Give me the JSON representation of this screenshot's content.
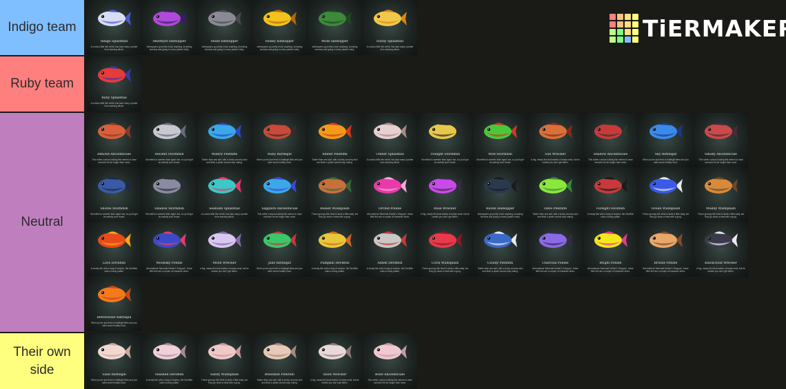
{
  "logo": {
    "text": "TiERMAKER",
    "grid_colors": [
      "#ff7f7f",
      "#ffbf7f",
      "#ffdf7f",
      "#ffff7f",
      "#ff7f7f",
      "#ffbf7f",
      "#ffdf7f",
      "#ffff7f",
      "#bfff7f",
      "#7fff7f",
      "#ffdf7f",
      "#ffff7f",
      "#bfff7f",
      "#7fff7f",
      "#7fbfff",
      "#ffff7f"
    ]
  },
  "tiers": [
    {
      "label": "Indigo team",
      "color": "#7fbfff",
      "items": [
        {
          "name": "Indigo Splashtail",
          "desc": "A curious little fish which has kept many a pirate from starving afloat.",
          "c1": "#d8dcf4",
          "c2": "#4b5bd8"
        },
        {
          "name": "Amethyst Islehopper",
          "desc": "Islehoppers go pretty much anything, including humans and going in every pirate's belly.",
          "c1": "#b04ad8",
          "c2": "#3a1a6a"
        },
        {
          "name": "Stone Islehopper",
          "desc": "Islehoppers go pretty much anything, including humans and going in every pirate's belly.",
          "c1": "#8a8a94",
          "c2": "#4a4a52"
        },
        {
          "name": "Honey Islehopper",
          "desc": "Islehoppers go pretty much anything, including humans and going in every pirate's belly.",
          "c1": "#f4c21a",
          "c2": "#b06a10"
        },
        {
          "name": "Moss Islehopper",
          "desc": "Islehoppers go pretty much anything, including humans and going in every pirate's belly.",
          "c1": "#3c8a3a",
          "c2": "#1e4a20"
        },
        {
          "name": "Sunny Splashtail",
          "desc": "A curious little fish which has kept many a pirate from starving afloat.",
          "c1": "#f2c84a",
          "c2": "#d88a1a"
        }
      ]
    },
    {
      "label": "Ruby team",
      "color": "#ff7f7f",
      "items": [
        {
          "name": "Ruby Splashtail",
          "desc": "A curious little fish which has kept many a pirate from starving afloat.",
          "c1": "#e83a3a",
          "c2": "#3a3aa8"
        }
      ]
    },
    {
      "label": "Neutral",
      "color": "#bf7fbf",
      "items": [
        {
          "name": "Almond Ancientscale",
          "desc": "This rather curious looking fish seems to have survived for far longer than most.",
          "c1": "#d8603a",
          "c2": "#8a3a2a"
        },
        {
          "name": "Ancient Stormfish",
          "desc": "Stormfish is sweeter than aged rum, so you'll get an awfully sore throat.",
          "c1": "#c8c8d0",
          "c2": "#6a6a78"
        },
        {
          "name": "Watery Plentifin",
          "desc": "Tastier than sea salt, with a lovely crunchy skin and flesh a pirate cannot stop eating.",
          "c1": "#3aa8ea",
          "c2": "#2a4ac8"
        },
        {
          "name": "Ruby Battlegill",
          "desc": "When you're just fresh a battlegill bites and you want some healthy food.",
          "c1": "#c84a3a",
          "c2": "#3a2a2a"
        },
        {
          "name": "Amber Plentifin",
          "desc": "Tastier than sea salt, with a lovely crunchy skin and flesh a pirate cannot stop eating.",
          "c1": "#f49a1a",
          "c2": "#d83a1a"
        },
        {
          "name": "Umber Splashtail",
          "desc": "A curious little fish which has kept many a pirate from starving afloat.",
          "c1": "#e8d0d0",
          "c2": "#a88a8a"
        },
        {
          "name": "Twilight Stormfish",
          "desc": "Stormfish is sweeter than aged rum, so you'll get an awfully sore throat.",
          "c1": "#e8c84a",
          "c2": "#2a2a2a"
        },
        {
          "name": "Wild Stormfish",
          "desc": "Stormfish is sweeter than aged rum, so you'll get an awfully sore throat.",
          "c1": "#4ac83a",
          "c2": "#c83a2a"
        },
        {
          "name": "Sun Wrecker",
          "desc": "A big, meaty fish that makes a hearty meal, but be careful you don't get bitten.",
          "c1": "#d8703a",
          "c2": "#8a2a1a"
        },
        {
          "name": "Shadow Ancientscale",
          "desc": "This rather curious looking fish seems to have survived for far longer than most.",
          "c1": "#c83a3a",
          "c2": "#2a3a2a"
        },
        {
          "name": "Sky Battlegill",
          "desc": "When you're just fresh a battlegill bites and you want some healthy food.",
          "c1": "#3a8aea",
          "c2": "#1a3a8a"
        },
        {
          "name": "Smoky Ancientscale",
          "desc": "This rather curious looking fish seems to have survived for far longer than most.",
          "c1": "#c84a4a",
          "c2": "#4a2a3a"
        },
        {
          "name": "Shores Stormfish",
          "desc": "Stormfish is sweeter than aged rum, so you'll get an awfully sore throat.",
          "c1": "#3a5aa8",
          "c2": "#1a2a4a"
        },
        {
          "name": "Shadow Stormfish",
          "desc": "Stormfish is sweeter than aged rum, so you'll get an awfully sore throat.",
          "c1": "#8a8aa0",
          "c2": "#2a2a3a"
        },
        {
          "name": "Seafoam Splashtail",
          "desc": "A curious little fish which has kept many a pirate from starving afloat.",
          "c1": "#3ac8c8",
          "c2": "#e83a6a"
        },
        {
          "name": "Sapphire Ancientscale",
          "desc": "This rather curious looking fish seems to have survived for far longer than most.",
          "c1": "#3aa8ea",
          "c2": "#3a4ad8"
        },
        {
          "name": "Russet Wildsplash",
          "desc": "These grumpy fish tend to taste a little salty, but they go down a treat with a grog.",
          "c1": "#c8703a",
          "c2": "#3a6a3a"
        },
        {
          "name": "Orchid Pondie",
          "desc": "Aberrational 'Mermaid Holder's Shopper', these little fish are a couple of character dives.",
          "c1": "#e83aa8",
          "c2": "#f4a8d8"
        },
        {
          "name": "Rose Wrecker",
          "desc": "A big, meaty fish that makes a hearty meal, but be careful you don't get bitten.",
          "c1": "#c84ae8",
          "c2": "#3a2a4a"
        },
        {
          "name": "Raven Islehopper",
          "desc": "Islehoppers go pretty much anything, including humans and going in every pirate's belly.",
          "c1": "#2a3a4a",
          "c2": "#1a1a2a"
        },
        {
          "name": "Olive Plentifin",
          "desc": "Tastier than sea salt, with a lovely crunchy skin and flesh a pirate cannot stop eating.",
          "c1": "#8ae83a",
          "c2": "#3a8a3a"
        },
        {
          "name": "Forsight Devilfish",
          "desc": "A meaty fish with a tang of sulphur, the Devilfish suits a hardy palate.",
          "c1": "#c83a3a",
          "c2": "#1a1a1a"
        },
        {
          "name": "Ocean Wildsplash",
          "desc": "These grumpy fish tend to taste a little salty, but they go down a treat with a grog.",
          "c1": "#3a5ae8",
          "c2": "#e8e8f0"
        },
        {
          "name": "Muddy Wildsplash",
          "desc": "These grumpy fish tend to taste a little salty, but they go down a treat with a grog.",
          "c1": "#d88a3a",
          "c2": "#6a4a2a"
        },
        {
          "name": "Lava Devilfish",
          "desc": "A meaty fish with a tang of sulphur, the Devilfish suits a hardy palate.",
          "c1": "#e84a1a",
          "c2": "#f4a81a"
        },
        {
          "name": "Moonsky Pondie",
          "desc": "Aberrational 'Mermaid Holder's Shopper', these little fish are a couple of character dives.",
          "c1": "#3a4ac8",
          "c2": "#e83a6a"
        },
        {
          "name": "Moon Wrecker",
          "desc": "A big, meaty fish that makes a hearty meal, but be careful you don't get bitten.",
          "c1": "#d8c8f0",
          "c2": "#8a6aa8"
        },
        {
          "name": "Jade Battlegill",
          "desc": "When you're just fresh a battlegill bites and you want some healthy food.",
          "c1": "#3ac86a",
          "c2": "#c83a3a"
        },
        {
          "name": "Pumpkin Devilfish",
          "desc": "A meaty fish with a tang of sulphur, the Devilfish suits a hardy palate.",
          "c1": "#e8c83a",
          "c2": "#d86a1a"
        },
        {
          "name": "Ashen Devilfish",
          "desc": "A meaty fish with a tang of sulphur, the Devilfish suits a hardy palate.",
          "c1": "#c8c8c8",
          "c2": "#c83a3a"
        },
        {
          "name": "Coral Wildsplash",
          "desc": "These grumpy fish tend to taste a little salty, but they go down a treat with a grog.",
          "c1": "#e83a4a",
          "c2": "#8a1a2a"
        },
        {
          "name": "Cloudy Plentifin",
          "desc": "Tastier than sea salt, with a lovely crunchy skin and flesh a pirate cannot stop eating.",
          "c1": "#3a6ac8",
          "c2": "#e8e8f0"
        },
        {
          "name": "Charcoal Pondie",
          "desc": "Aberrational 'Mermaid Holder's Shopper', these little fish are a couple of character dives.",
          "c1": "#8a6ae8",
          "c2": "#3a2a4a"
        },
        {
          "name": "Bright Pondie",
          "desc": "Aberrational 'Mermaid Holder's Shopper', these little fish are a couple of character dives.",
          "c1": "#f4e81a",
          "c2": "#e83a8a"
        },
        {
          "name": "Bronze Pondie",
          "desc": "Aberrational 'Mermaid Holder's Shopper', these little fish are a couple of character dives.",
          "c1": "#e8a86a",
          "c2": "#8a4a2a"
        },
        {
          "name": "Blackcloud Wrecker",
          "desc": "A big, meaty fish that makes a hearty meal, but be careful you don't get bitten.",
          "c1": "#3a3a4a",
          "c2": "#e8e8f0"
        },
        {
          "name": "Bittersweet Battlegill",
          "desc": "When you're just fresh a battlegill bites and you want some healthy food.",
          "c1": "#f47a1a",
          "c2": "#c84a1a"
        }
      ]
    },
    {
      "label": "Their own side",
      "color": "#ffff7f",
      "items": [
        {
          "name": "Sand Battlegill",
          "desc": "When you're just fresh a battlegill bites and you want some healthy food.",
          "c1": "#f0d8d0",
          "c2": "#c8a8a0"
        },
        {
          "name": "Seashell Devilfish",
          "desc": "A meaty fish with a tang of sulphur, the Devilfish suits a hardy palate.",
          "c1": "#f0d0d8",
          "c2": "#a88a9a"
        },
        {
          "name": "Sandy Wildsplash",
          "desc": "These grumpy fish tend to taste a little salty, but they go down a treat with a grog.",
          "c1": "#f0c8c8",
          "c2": "#c89a9a"
        },
        {
          "name": "Bonedust Plentifin",
          "desc": "Tastier than sea salt, with a lovely crunchy skin and flesh a pirate cannot stop eating.",
          "c1": "#e8c8b8",
          "c2": "#a88a7a"
        },
        {
          "name": "Snow Wrecker",
          "desc": "A big, meaty fish that makes a hearty meal, but be careful you don't get bitten.",
          "c1": "#e8d8d8",
          "c2": "#8a7a7a"
        },
        {
          "name": "Bone Ancientscale",
          "desc": "This rather curious looking fish seems to have survived for far longer than most.",
          "c1": "#f0c8d0",
          "c2": "#c898a8"
        }
      ]
    }
  ]
}
